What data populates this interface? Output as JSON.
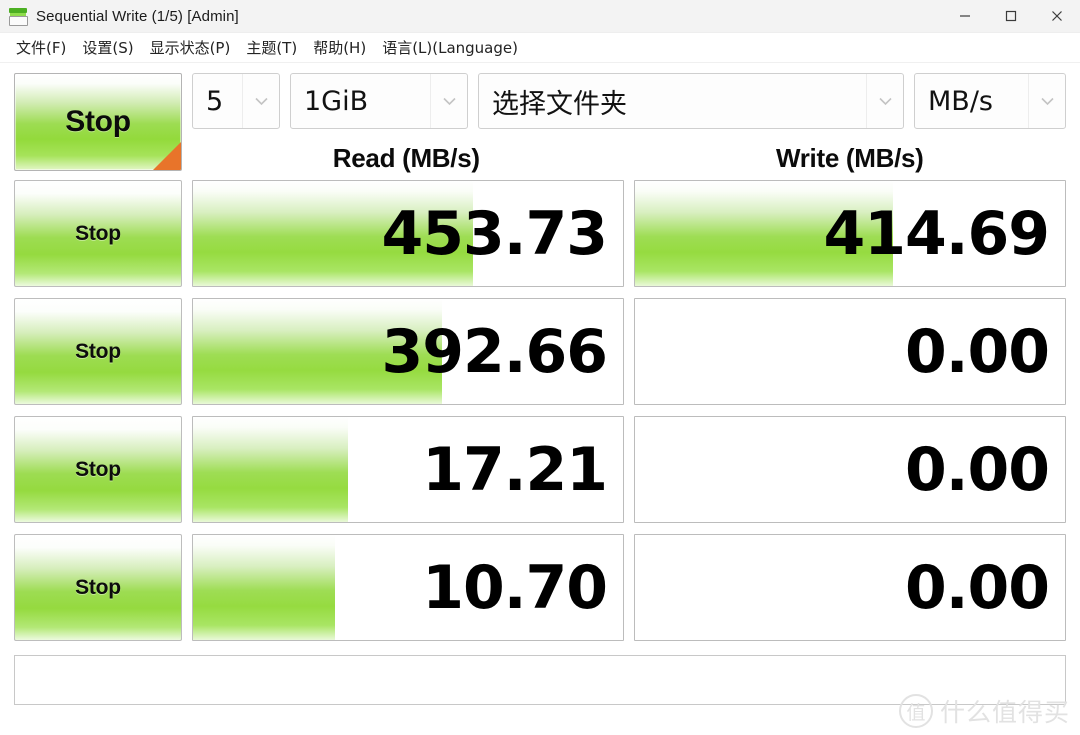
{
  "window": {
    "title": "Sequential Write (1/5) [Admin]",
    "icon": "drive-icon",
    "controls": {
      "minimize": "minimize-icon",
      "maximize": "maximize-icon",
      "close": "close-icon"
    }
  },
  "menu": {
    "items": [
      {
        "label": "文件(F)"
      },
      {
        "label": "设置(S)"
      },
      {
        "label": "显示状态(P)"
      },
      {
        "label": "主题(T)"
      },
      {
        "label": "帮助(H)"
      },
      {
        "label": "语言(L)(Language)"
      }
    ]
  },
  "toolbar": {
    "main_button_label": "Stop",
    "run_count": "5",
    "test_size": "1GiB",
    "folder": "选择文件夹",
    "unit": "MB/s"
  },
  "columns": {
    "read": "Read (MB/s)",
    "write": "Write (MB/s)"
  },
  "rows": [
    {
      "button_label": "Stop",
      "read_value": "453.73",
      "read_fill_pct": 65,
      "write_value": "414.69",
      "write_fill_pct": 60
    },
    {
      "button_label": "Stop",
      "read_value": "392.66",
      "read_fill_pct": 58,
      "write_value": "0.00",
      "write_fill_pct": 0
    },
    {
      "button_label": "Stop",
      "read_value": "17.21",
      "read_fill_pct": 36,
      "write_value": "0.00",
      "write_fill_pct": 0
    },
    {
      "button_label": "Stop",
      "read_value": "10.70",
      "read_fill_pct": 33,
      "write_value": "0.00",
      "write_fill_pct": 0
    }
  ],
  "status": {
    "text": ""
  },
  "watermark": {
    "badge": "值",
    "text": "什么值得买"
  },
  "colors": {
    "green_accent": "#95da3f",
    "orange_corner": "#e8742a",
    "titlebar_bg": "#f3f3f3"
  }
}
